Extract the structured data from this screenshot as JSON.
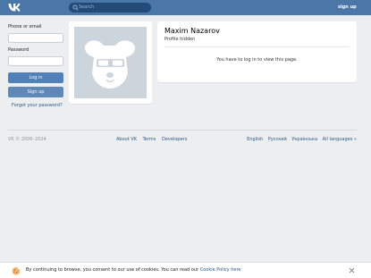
{
  "header": {
    "search_placeholder": "Search",
    "signup_link": "sign up"
  },
  "login": {
    "phone_label": "Phone or email",
    "password_label": "Password",
    "login_button": "Log in",
    "signup_button": "Sign up",
    "forgot_link": "Forgot your password?"
  },
  "profile": {
    "name": "Maxim Nazarov",
    "status": "Profile hidden",
    "private_message": "You have to log in to view this page."
  },
  "footer": {
    "copyright": "VK © 2006–2024",
    "links": [
      "About VK",
      "Terms",
      "Developers"
    ],
    "languages": [
      "English",
      "Русский",
      "Українська",
      "All languages »"
    ]
  },
  "cookie": {
    "text": "By continuing to browse, you consent to our use of cookies. You can read our ",
    "link": "Cookie Policy here"
  },
  "colors": {
    "brand": "#4a76a8",
    "button": "#5181b8",
    "link": "#2a5885"
  }
}
